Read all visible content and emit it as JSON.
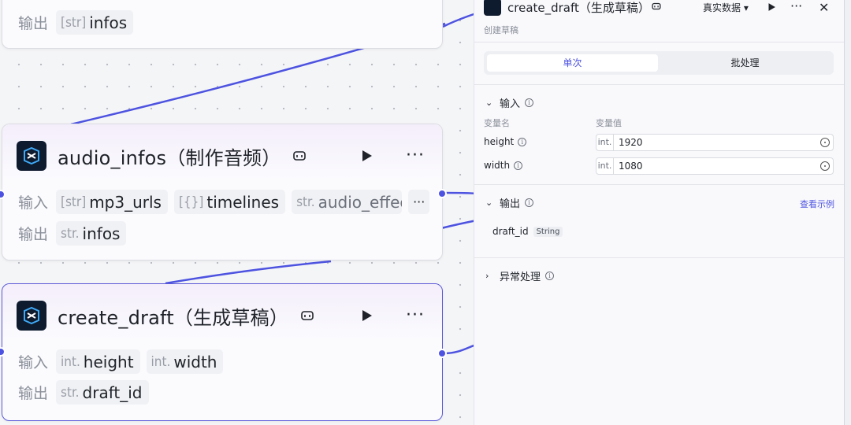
{
  "colors": {
    "accent": "#4d53e0",
    "selected_border": "#5b59d8",
    "edge": "#4d53e0"
  },
  "node_top": {
    "output_label": "输出",
    "outputs": [
      {
        "type": "[str]",
        "name": "infos"
      }
    ]
  },
  "node_audio": {
    "title": "audio_infos（制作音频）",
    "input_label": "输入",
    "output_label": "输出",
    "inputs": [
      {
        "type": "[str]",
        "name": "mp3_urls"
      },
      {
        "type": "[{}]",
        "name": "timelines"
      },
      {
        "type": "str.",
        "name": "audio_effect"
      }
    ],
    "more_inputs": "···",
    "outputs": [
      {
        "type": "str.",
        "name": "infos"
      }
    ]
  },
  "node_draft": {
    "title": "create_draft（生成草稿）",
    "input_label": "输入",
    "output_label": "输出",
    "inputs": [
      {
        "type": "int.",
        "name": "height"
      },
      {
        "type": "int.",
        "name": "width"
      }
    ],
    "outputs": [
      {
        "type": "str.",
        "name": "draft_id"
      }
    ]
  },
  "panel": {
    "title": "create_draft（生成草稿）",
    "data_source": "真实数据 ▾",
    "more": "···",
    "close": "✕",
    "subtitle": "创建草稿",
    "tabs": [
      "单次",
      "批处理"
    ],
    "input_section": "输入",
    "col_name": "变量名",
    "col_value": "变量值",
    "vars": [
      {
        "name": "height",
        "type": "int.",
        "value": "1920"
      },
      {
        "name": "width",
        "type": "int.",
        "value": "1080"
      }
    ],
    "output_section": "输出",
    "view_example": "查看示例",
    "output_var": {
      "name": "draft_id",
      "type": "String"
    },
    "error_section": "异常处理"
  }
}
